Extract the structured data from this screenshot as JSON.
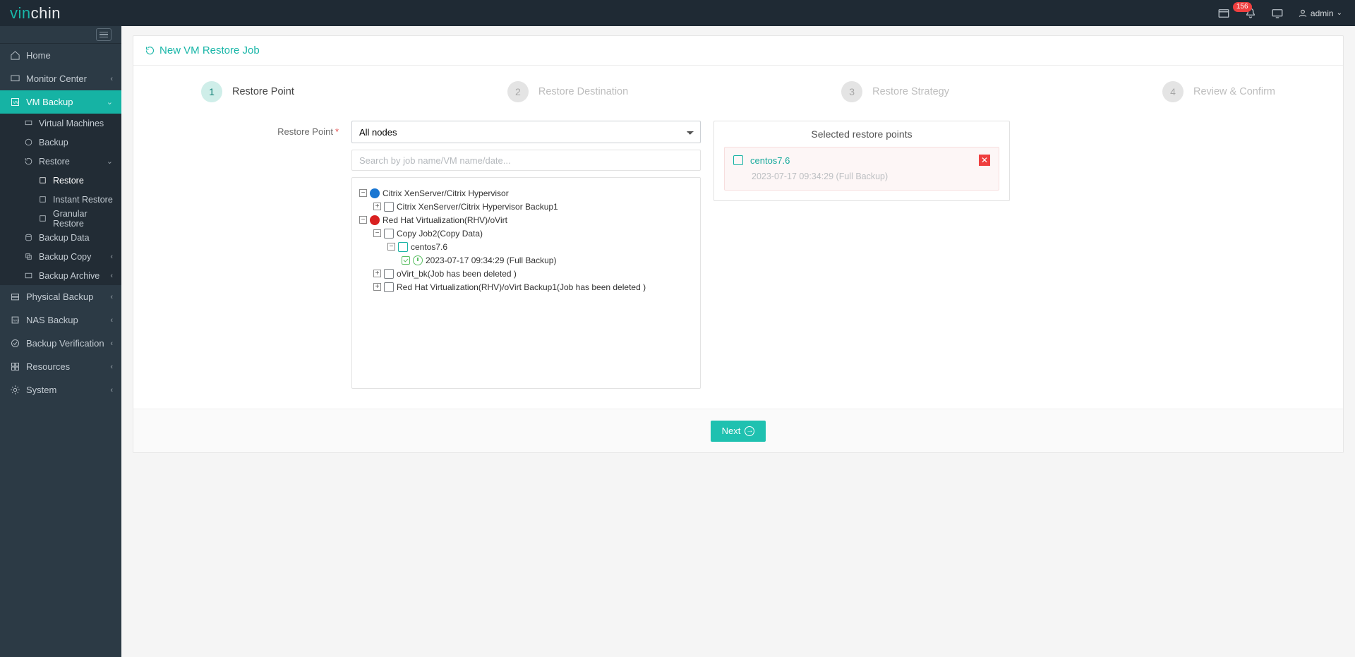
{
  "brand": {
    "part1": "vin",
    "part2": "chin"
  },
  "topbar": {
    "notif_count": "156",
    "user": "admin"
  },
  "sidebar": {
    "home": "Home",
    "monitor": "Monitor Center",
    "vmbackup": "VM Backup",
    "virtual_machines": "Virtual Machines",
    "backup": "Backup",
    "restore": "Restore",
    "restore_sub": "Restore",
    "instant_restore": "Instant Restore",
    "granular_restore": "Granular Restore",
    "backup_data": "Backup Data",
    "backup_copy": "Backup Copy",
    "backup_archive": "Backup Archive",
    "physical_backup": "Physical Backup",
    "nas_backup": "NAS Backup",
    "backup_verification": "Backup Verification",
    "resources": "Resources",
    "system": "System"
  },
  "page": {
    "title": "New VM Restore Job",
    "steps": {
      "s1": "Restore Point",
      "s2": "Restore Destination",
      "s3": "Restore Strategy",
      "s4": "Review & Confirm"
    },
    "restore_point_label": "Restore Point",
    "node_select": "All nodes",
    "search_placeholder": "Search by job name/VM name/date...",
    "tree": {
      "citrix": "Citrix XenServer/Citrix Hypervisor",
      "citrix_backup1": "Citrix XenServer/Citrix Hypervisor Backup1",
      "rhv": "Red Hat Virtualization(RHV)/oVirt",
      "copy_job": "Copy Job2(Copy Data)",
      "centos": "centos7.6",
      "restore_point": "2023-07-17 09:34:29 (Full  Backup)",
      "ovirt_bk": "oVirt_bk(Job has been deleted )",
      "rhv_backup1": "Red Hat Virtualization(RHV)/oVirt Backup1(Job has been deleted )"
    },
    "selected_title": "Selected restore points",
    "selected": {
      "vm": "centos7.6",
      "detail": "2023-07-17 09:34:29 (Full Backup)"
    },
    "next": "Next"
  }
}
